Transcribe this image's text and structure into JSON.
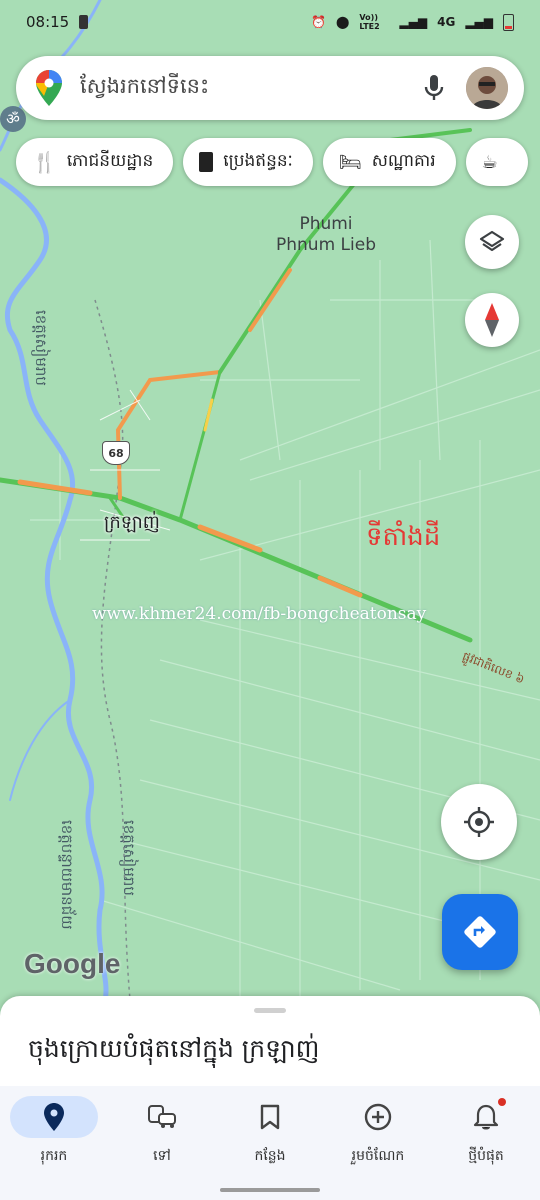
{
  "status_bar": {
    "time": "08:15",
    "network": "4G",
    "lte": "Vo)) LTE2"
  },
  "search": {
    "placeholder": "ស្វែងរកនៅទីនេះ"
  },
  "chips": [
    {
      "label": "ភោជនីយដ្ឋាន",
      "icon": "restaurant-icon"
    },
    {
      "label": "ប្រេងឥន្ធនៈ",
      "icon": "gas-station-icon"
    },
    {
      "label": "សណ្ឋាគារ",
      "icon": "hotel-icon"
    }
  ],
  "map": {
    "place_village": "Phumi\nPhnum Lieb",
    "place_town": "ក្រឡាញ់",
    "route_shield": "68",
    "annotation": "ទីតាំងដី",
    "annotation_color": "#e53935",
    "watermark": "www.khmer24.com/fb-bongcheatonsay",
    "river_label_1": "ខេត្តសៀមរាប",
    "river_label_2": "ខេត្តបន្ទាយមានជ័យ",
    "river_label_3": "ខេត្តសៀមរាប",
    "road_label": "ផ្លូវជាតិលេខ ៦",
    "google_logo": "Google",
    "om_label": "ॐ"
  },
  "sheet": {
    "title": "ចុងក្រោយបំផុតនៅក្នុង ក្រឡាញ់"
  },
  "nav": [
    {
      "label": "រុករក",
      "icon": "explore-pin-icon",
      "active": true
    },
    {
      "label": "ទៅ",
      "icon": "commute-icon",
      "active": false
    },
    {
      "label": "កន្លែង",
      "icon": "bookmark-icon",
      "active": false
    },
    {
      "label": "រួមចំណែក",
      "icon": "add-circle-icon",
      "active": false
    },
    {
      "label": "ថ្មីបំផុត",
      "icon": "notification-bell-icon",
      "active": false
    }
  ],
  "colors": {
    "accent": "#1a73e8",
    "map_bg": "#a8ddb5",
    "water": "#8ab4f8"
  }
}
